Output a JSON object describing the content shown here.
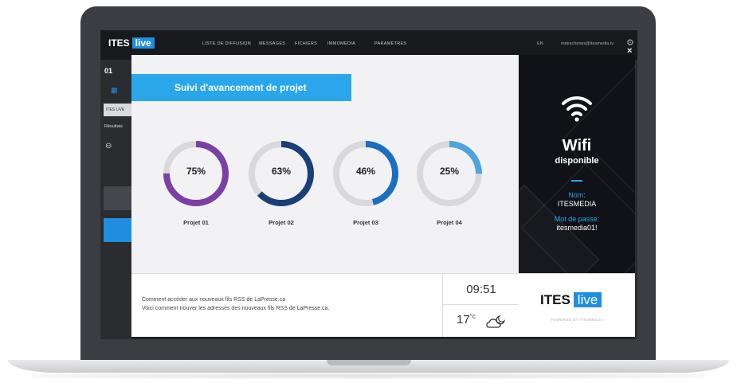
{
  "app": {
    "logo_text": "ITES",
    "logo_badge": "live",
    "nav": [
      "LISTE DE DIFFUSION",
      "MESSAGES",
      "FICHIERS",
      "IMMOMEDIA",
      "PARAMÈTRES"
    ],
    "lang": "EN",
    "user_email": "mdeschenes@itesmedia.tv",
    "step_label": "01",
    "chip_text": "ITES LIVE",
    "results_label": "Résultats"
  },
  "modal": {
    "title": "Suivi d'avancement de projet",
    "projects": [
      {
        "label": "Projet 01",
        "value_text": "75%",
        "percent": 75,
        "color": "#7b3fa6"
      },
      {
        "label": "Projet 02",
        "value_text": "63%",
        "percent": 63,
        "color": "#1a3f78"
      },
      {
        "label": "Projet 03",
        "value_text": "46%",
        "percent": 46,
        "color": "#1b6ec0"
      },
      {
        "label": "Projet 04",
        "value_text": "25%",
        "percent": 25,
        "color": "#4fa4e0"
      }
    ],
    "close_glyph": "×"
  },
  "wifi": {
    "title": "Wifi",
    "subtitle": "disponible",
    "name_key": "Nom:",
    "name_value": "ITESMEDIA",
    "password_key": "Mot de passe:",
    "password_value": "itesmedia01!"
  },
  "news": {
    "line1": "Comment accéder aux nouveaux fils RSS de LaPresse.ca",
    "line2": "Voici comment trouver les adresses des nouveaux fils RSS de LaPresse.ca."
  },
  "clock": {
    "time": "09:51"
  },
  "weather": {
    "temp": "17",
    "unit": "°c",
    "icon": "partly-cloudy-night-icon"
  },
  "brand": {
    "name": "ITES",
    "badge": "live",
    "tagline": "POWERED BY ITESMEDIA"
  },
  "colors": {
    "accent": "#2aa7ea",
    "ring_track": "#d9d9dc",
    "panel_dark": "#111217"
  }
}
